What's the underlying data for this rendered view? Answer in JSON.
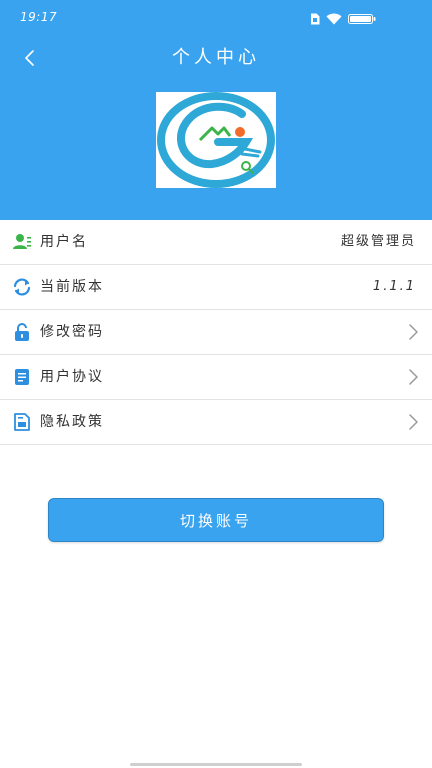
{
  "colors": {
    "primary": "#3aa3ef",
    "text": "#333333",
    "divider": "#e3e3e3",
    "chevron": "#9a9a9a"
  },
  "status_bar": {
    "time": "19:17"
  },
  "header": {
    "title": "个人中心"
  },
  "profile": {
    "logo_icon": "app-logo-icon"
  },
  "rows": [
    {
      "icon": "user-icon",
      "label": "用户名",
      "value": "超级管理员"
    },
    {
      "icon": "refresh-icon",
      "label": "当前版本",
      "value": "1.1.1"
    },
    {
      "icon": "lock-icon",
      "label": "修改密码",
      "chevron": true
    },
    {
      "icon": "document-icon",
      "label": "用户协议",
      "chevron": true
    },
    {
      "icon": "privacy-document-icon",
      "label": "隐私政策",
      "chevron": true
    }
  ],
  "actions": {
    "switch_account_label": "切换账号"
  }
}
